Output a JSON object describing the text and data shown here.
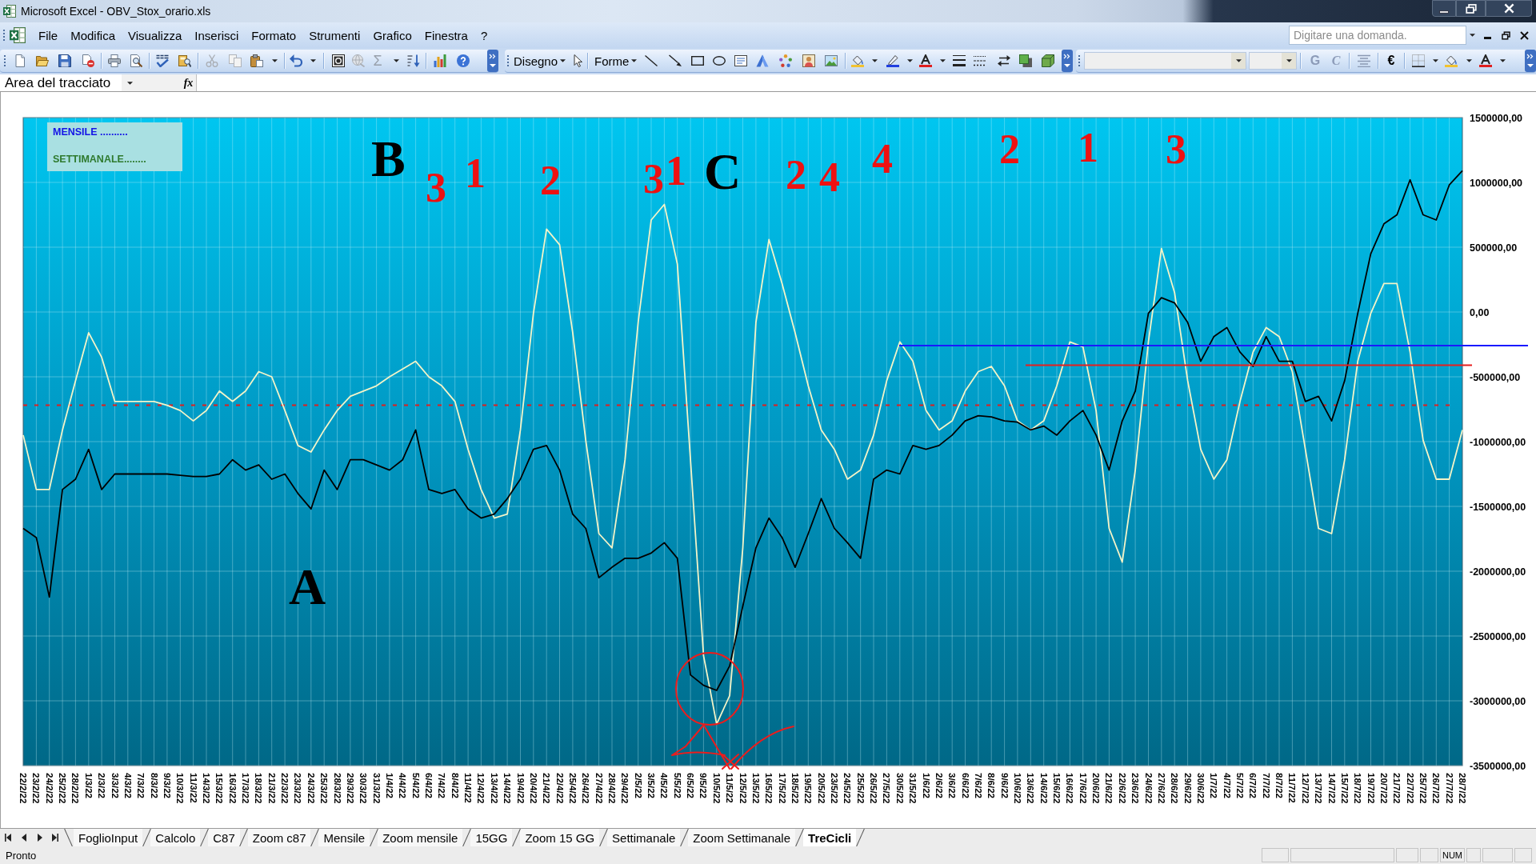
{
  "window": {
    "title": "Microsoft Excel - OBV_Stox_orario.xls"
  },
  "menu_bar": {
    "items": [
      "File",
      "Modifica",
      "Visualizza",
      "Inserisci",
      "Formato",
      "Strumenti",
      "Grafico",
      "Finestra",
      "?"
    ],
    "help_field": {
      "placeholder": "Digitare una domanda."
    }
  },
  "toolbars": {
    "autosum": {
      "label": "Σ",
      "disabled": true
    },
    "drawing_menus": [
      "Disegno",
      "Forme"
    ],
    "font_name_field": {
      "disabled": true
    },
    "font_size_field": {
      "disabled": true
    },
    "format_buttons": [
      {
        "label": "G",
        "kind": "bold",
        "disabled": true
      },
      {
        "label": "C",
        "kind": "italic",
        "disabled": true
      },
      {
        "label": "€",
        "kind": "currency",
        "disabled": false
      }
    ]
  },
  "formula_bar": {
    "name_box": "Area del tracciato",
    "function_label": "fx"
  },
  "chart": {
    "text_box": [
      {
        "text": "MENSILE ..........",
        "color": "#1414e6"
      },
      {
        "text": "SETTIMANALE........",
        "color": "#2e7a2e"
      }
    ],
    "annotations": [
      {
        "text": "B",
        "color": "#000000"
      },
      {
        "text": "3",
        "color": "#ee1111"
      },
      {
        "text": "1",
        "color": "#ee1111"
      },
      {
        "text": "2",
        "color": "#ee1111"
      },
      {
        "text": "3",
        "color": "#ee1111"
      },
      {
        "text": "1",
        "color": "#ee1111"
      },
      {
        "text": "C",
        "color": "#000000"
      },
      {
        "text": "2",
        "color": "#ee1111"
      },
      {
        "text": "4",
        "color": "#ee1111"
      },
      {
        "text": "4",
        "color": "#ee1111"
      },
      {
        "text": "2",
        "color": "#ee1111"
      },
      {
        "text": "1",
        "color": "#ee1111"
      },
      {
        "text": "3",
        "color": "#ee1111"
      },
      {
        "text": "A",
        "color": "#000000"
      }
    ],
    "chart_data": {
      "type": "line",
      "grid": true,
      "categories": [
        "22/2/22",
        "23/2/22",
        "24/2/22",
        "25/2/22",
        "28/2/22",
        "1/3/22",
        "2/3/22",
        "3/3/22",
        "4/3/22",
        "7/3/22",
        "8/3/22",
        "9/3/22",
        "10/3/22",
        "11/3/22",
        "14/3/22",
        "15/3/22",
        "16/3/22",
        "17/3/22",
        "18/3/22",
        "21/3/22",
        "22/3/22",
        "23/3/22",
        "24/3/22",
        "25/3/22",
        "28/3/22",
        "29/3/22",
        "30/3/22",
        "31/3/22",
        "1/4/22",
        "4/4/22",
        "5/4/22",
        "6/4/22",
        "7/4/22",
        "8/4/22",
        "11/4/22",
        "12/4/22",
        "13/4/22",
        "14/4/22",
        "19/4/22",
        "20/4/22",
        "21/4/22",
        "22/4/22",
        "25/4/22",
        "26/4/22",
        "27/4/22",
        "28/4/22",
        "29/4/22",
        "2/5/22",
        "3/5/22",
        "4/5/22",
        "5/5/22",
        "6/5/22",
        "9/5/22",
        "10/5/22",
        "11/5/22",
        "12/5/22",
        "13/5/22",
        "16/5/22",
        "17/5/22",
        "18/5/22",
        "19/5/22",
        "20/5/22",
        "23/5/22",
        "24/5/22",
        "25/5/22",
        "26/5/22",
        "27/5/22",
        "30/5/22",
        "31/5/22",
        "1/6/22",
        "2/6/22",
        "3/6/22",
        "6/6/22",
        "7/6/22",
        "8/6/22",
        "9/6/22",
        "10/6/22",
        "13/6/22",
        "14/6/22",
        "15/6/22",
        "16/6/22",
        "17/6/22",
        "20/6/22",
        "21/6/22",
        "22/6/22",
        "23/6/22",
        "24/6/22",
        "27/6/22",
        "28/6/22",
        "29/6/22",
        "30/6/22",
        "1/7/22",
        "4/7/22",
        "5/7/22",
        "6/7/22",
        "7/7/22",
        "8/7/22",
        "11/7/22",
        "12/7/22",
        "13/7/22",
        "14/7/22",
        "15/7/22",
        "18/7/22",
        "19/7/22",
        "20/7/22",
        "21/7/22",
        "22/7/22",
        "25/7/22",
        "26/7/22",
        "27/7/22",
        "28/7/22"
      ],
      "series": [
        {
          "color": "#000000",
          "values": [
            -1670000,
            -1740000,
            -2200000,
            -1370000,
            -1290000,
            -1060000,
            -1370000,
            -1250000,
            -1250000,
            -1250000,
            -1250000,
            -1250000,
            -1260000,
            -1270000,
            -1270000,
            -1250000,
            -1140000,
            -1220000,
            -1180000,
            -1290000,
            -1250000,
            -1400000,
            -1520000,
            -1220000,
            -1370000,
            -1140000,
            -1140000,
            -1180000,
            -1220000,
            -1140000,
            -910000,
            -1370000,
            -1400000,
            -1370000,
            -1520000,
            -1590000,
            -1560000,
            -1440000,
            -1290000,
            -1060000,
            -1030000,
            -1220000,
            -1560000,
            -1670000,
            -2050000,
            -1970000,
            -1900000,
            -1900000,
            -1860000,
            -1780000,
            -1900000,
            -2800000,
            -2880000,
            -2920000,
            -2730000,
            -2270000,
            -1820000,
            -1590000,
            -1740000,
            -1970000,
            -1710000,
            -1440000,
            -1670000,
            -1780000,
            -1900000,
            -1290000,
            -1220000,
            -1250000,
            -1030000,
            -1060000,
            -1030000,
            -950000,
            -840000,
            -800000,
            -810000,
            -840000,
            -850000,
            -910000,
            -880000,
            -950000,
            -840000,
            -760000,
            -950000,
            -1220000,
            -840000,
            -610000,
            -10000,
            110000,
            70000,
            -80000,
            -380000,
            -190000,
            -120000,
            -310000,
            -420000,
            -190000,
            -380000,
            -380000,
            -690000,
            -650000,
            -840000,
            -530000,
            -10000,
            450000,
            680000,
            750000,
            1020000,
            750000,
            710000,
            980000,
            1090000
          ]
        },
        {
          "color": "#f4f4c8",
          "values": [
            -950000,
            -1370000,
            -1370000,
            -910000,
            -530000,
            -160000,
            -350000,
            -690000,
            -690000,
            -690000,
            -690000,
            -720000,
            -760000,
            -840000,
            -760000,
            -610000,
            -690000,
            -610000,
            -460000,
            -500000,
            -760000,
            -1030000,
            -1080000,
            -910000,
            -760000,
            -650000,
            -610000,
            -570000,
            -500000,
            -440000,
            -380000,
            -500000,
            -570000,
            -690000,
            -1060000,
            -1370000,
            -1590000,
            -1560000,
            -910000,
            -10000,
            640000,
            520000,
            -160000,
            -990000,
            -1710000,
            -1820000,
            -1140000,
            -80000,
            710000,
            830000,
            370000,
            -1140000,
            -2650000,
            -3180000,
            -2960000,
            -1820000,
            -80000,
            560000,
            220000,
            -160000,
            -570000,
            -910000,
            -1060000,
            -1290000,
            -1220000,
            -950000,
            -530000,
            -230000,
            -380000,
            -760000,
            -910000,
            -840000,
            -610000,
            -460000,
            -420000,
            -570000,
            -840000,
            -910000,
            -840000,
            -570000,
            -230000,
            -270000,
            -760000,
            -1670000,
            -1930000,
            -1220000,
            -230000,
            490000,
            150000,
            -530000,
            -1060000,
            -1290000,
            -1140000,
            -690000,
            -310000,
            -120000,
            -190000,
            -460000,
            -1060000,
            -1670000,
            -1710000,
            -1140000,
            -380000,
            -10000,
            220000,
            220000,
            -310000,
            -990000,
            -1290000,
            -1290000,
            -910000
          ]
        }
      ],
      "ref_lines": [
        {
          "axis": "y",
          "value": -260000,
          "color": "#1a1aff"
        },
        {
          "axis": "y",
          "value": -410000,
          "color": "#e81e1e"
        },
        {
          "axis": "y",
          "value": -720000,
          "color": "#e01e1e"
        }
      ],
      "ylim": [
        -3500000,
        1500000
      ],
      "yticks": [
        {
          "value": 1500000,
          "label": "1500000,00"
        },
        {
          "value": 1000000,
          "label": "1000000,00"
        },
        {
          "value": 500000,
          "label": "500000,00"
        },
        {
          "value": 0,
          "label": "0,00"
        },
        {
          "value": -500000,
          "label": "-500000,00"
        },
        {
          "value": -1000000,
          "label": "-1000000,00"
        },
        {
          "value": -1500000,
          "label": "-1500000,00"
        },
        {
          "value": -2000000,
          "label": "-2000000,00"
        },
        {
          "value": -2500000,
          "label": "-2500000,00"
        },
        {
          "value": -3000000,
          "label": "-3000000,00"
        },
        {
          "value": -3500000,
          "label": "-3500000,00"
        }
      ]
    }
  },
  "sheet_tabs": [
    {
      "label": "FoglioInput",
      "selected": false
    },
    {
      "label": "Calcolo",
      "selected": false
    },
    {
      "label": "C87",
      "selected": false
    },
    {
      "label": "Zoom c87",
      "selected": false
    },
    {
      "label": "Mensile",
      "selected": false
    },
    {
      "label": "Zoom mensile",
      "selected": false
    },
    {
      "label": "15GG",
      "selected": false
    },
    {
      "label": "Zoom 15 GG",
      "selected": false
    },
    {
      "label": "Settimanale",
      "selected": false
    },
    {
      "label": "Zoom Settimanale",
      "selected": false
    },
    {
      "label": "TreCicli",
      "selected": true
    }
  ],
  "status_bar": {
    "message": "Pronto",
    "indicator": "NUM"
  }
}
